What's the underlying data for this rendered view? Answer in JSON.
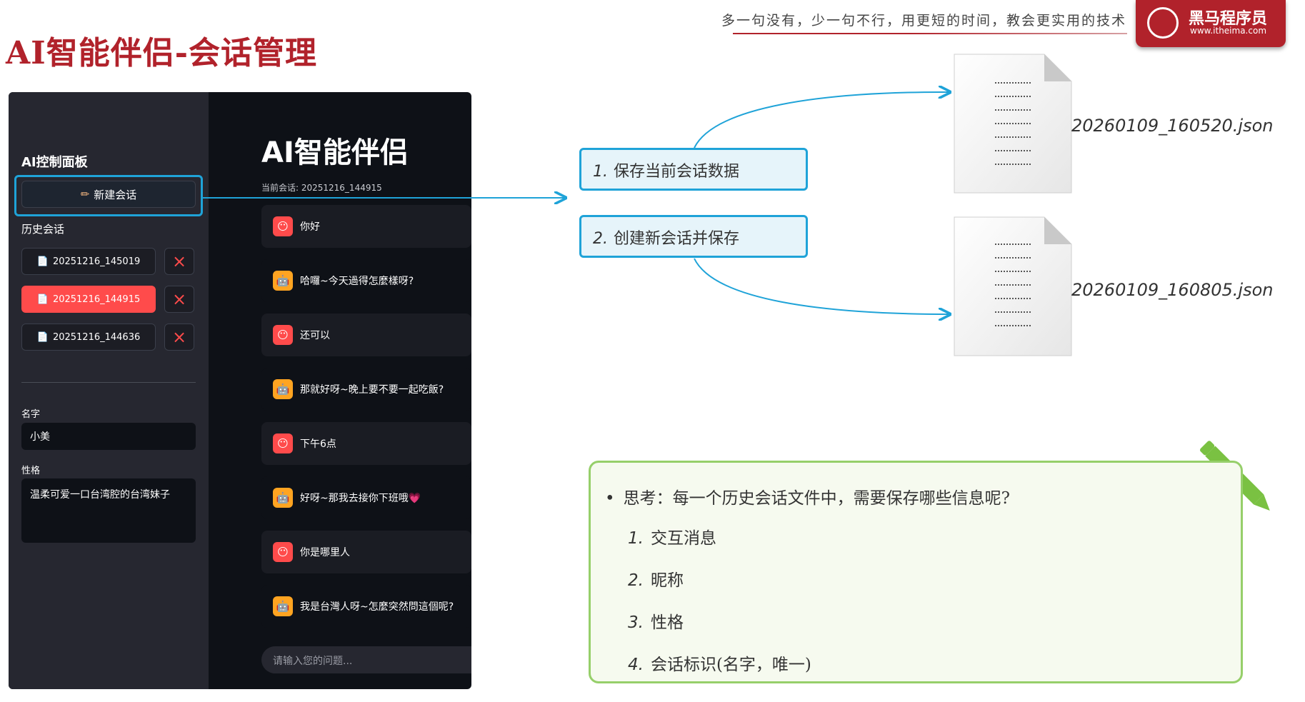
{
  "slide": {
    "title": "AI智能伴侣-会话管理",
    "slogan": "多一句没有，少一句不行，用更短的时间，教会更实用的技术",
    "logo": {
      "name": "黑马程序员",
      "url": "www.itheima.com"
    }
  },
  "app": {
    "sidebar": {
      "title": "AI控制面板",
      "new_chat_label": "新建会话",
      "history_label": "历史会话",
      "sessions": [
        {
          "label": "20251216_145019",
          "active": false
        },
        {
          "label": "20251216_144915",
          "active": true
        },
        {
          "label": "20251216_144636",
          "active": false
        }
      ],
      "delete_icon": "×",
      "name_label": "名字",
      "name_value": "小美",
      "personality_label": "性格",
      "personality_value": "温柔可爱一口台湾腔的台湾妹子"
    },
    "main": {
      "title": "AI智能伴侣",
      "current_session": "当前会话: 20251216_144915",
      "messages": [
        {
          "role": "user",
          "text": "你好"
        },
        {
          "role": "ai",
          "text": "哈囉~今天過得怎麼樣呀?"
        },
        {
          "role": "user",
          "text": "还可以"
        },
        {
          "role": "ai",
          "text": "那就好呀~晚上要不要一起吃飯?"
        },
        {
          "role": "user",
          "text": "下午6点"
        },
        {
          "role": "ai",
          "text": "好呀~那我去接你下班哦💗"
        },
        {
          "role": "user",
          "text": "你是哪里人"
        },
        {
          "role": "ai",
          "text": "我是台灣人呀~怎麼突然問這個呢?"
        }
      ],
      "input_placeholder": "请输入您的问题..."
    }
  },
  "steps": [
    {
      "num": "1.",
      "text": "保存当前会话数据"
    },
    {
      "num": "2.",
      "text": "创建新会话并保存"
    }
  ],
  "files": [
    {
      "name": "20260109_160520.json"
    },
    {
      "name": "20260109_160805.json"
    }
  ],
  "think": {
    "question": "思考：每一个历史会话文件中，需要保存哪些信息呢?",
    "items": [
      {
        "num": "1.",
        "text": "交互消息"
      },
      {
        "num": "2.",
        "text": "昵称"
      },
      {
        "num": "3.",
        "text": "性格"
      },
      {
        "num": "4.",
        "text": "会话标识(名字，唯一)"
      }
    ]
  },
  "colors": {
    "brand_red": "#b1222b",
    "accent_blue": "#1fa3d8",
    "streamlit_red": "#ff4b4b",
    "ai_avatar_orange": "#ffa421",
    "think_green": "#96cf6a"
  }
}
